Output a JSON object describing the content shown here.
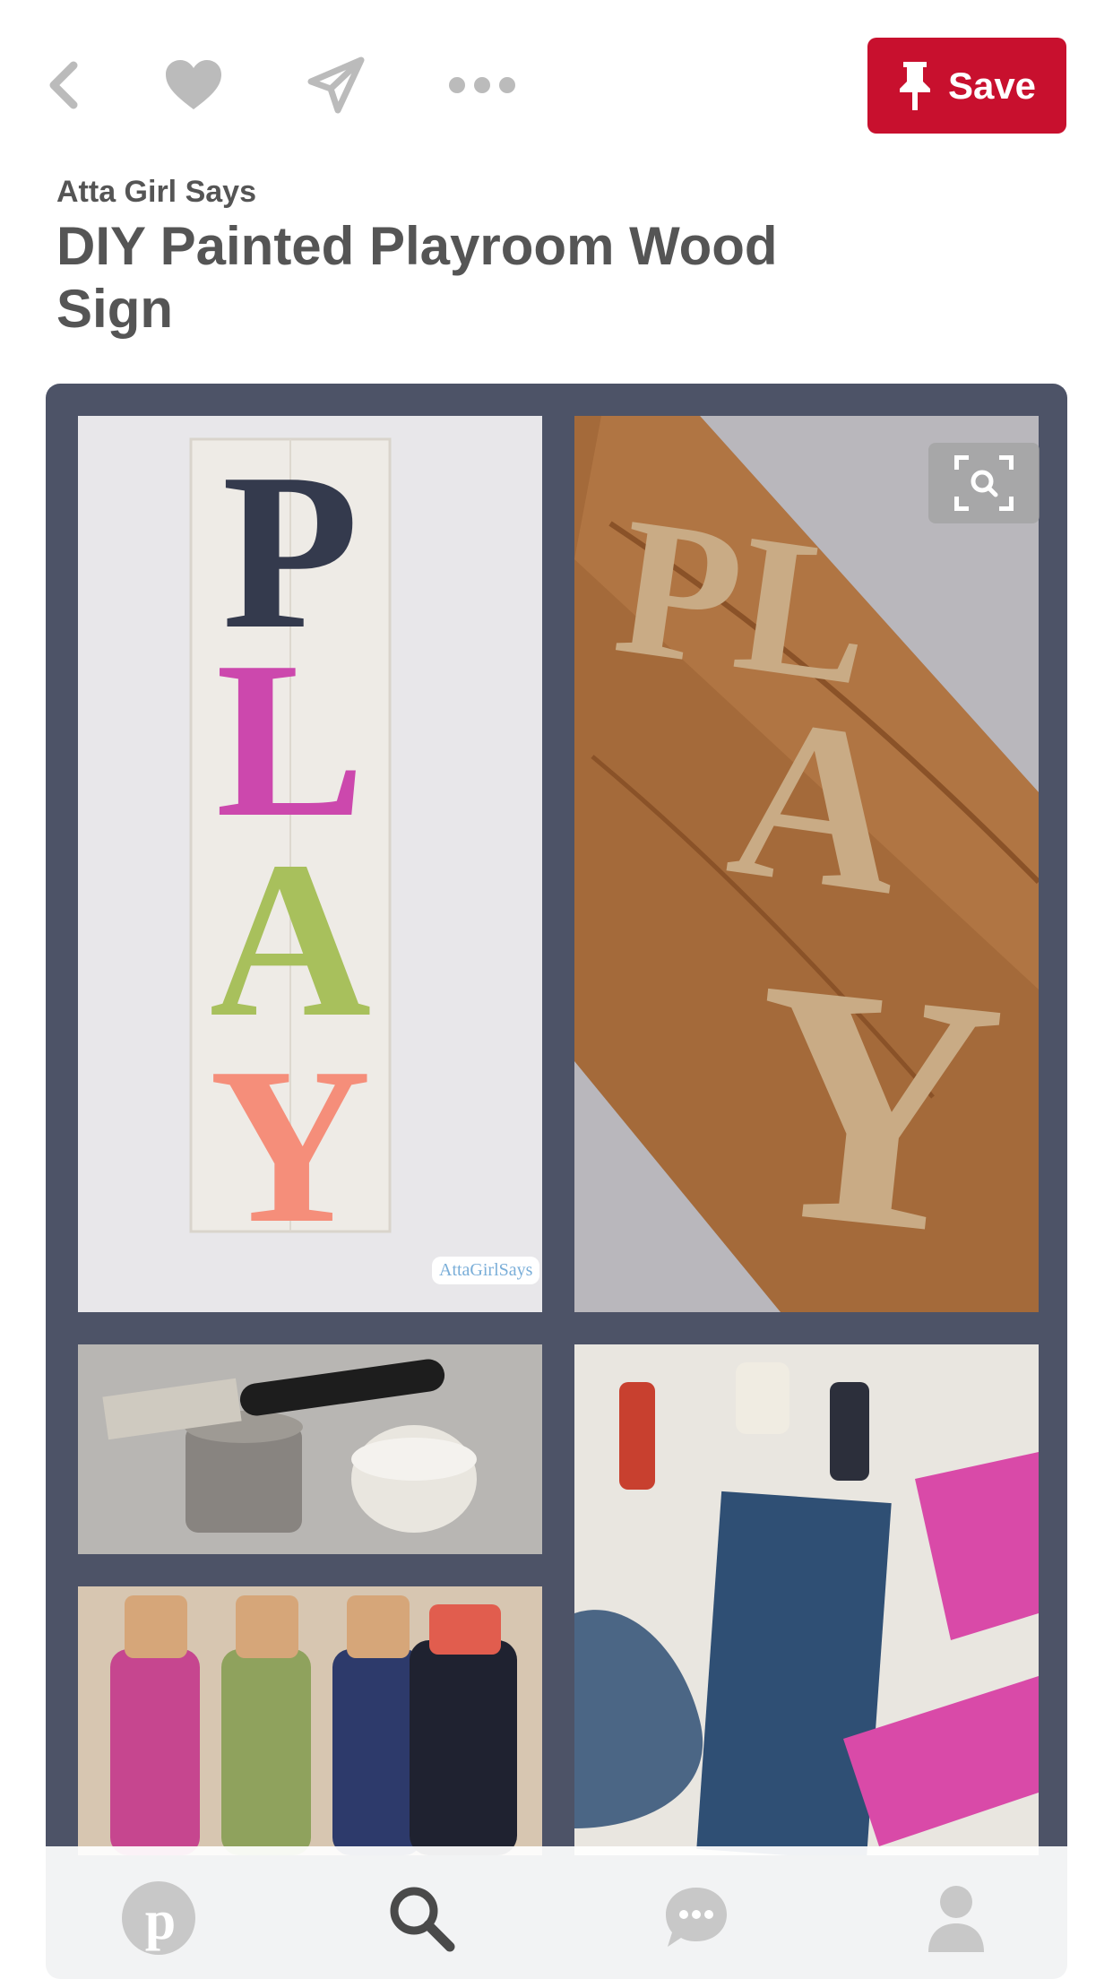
{
  "toolbar": {
    "back_icon": "chevron-left-icon",
    "like_icon": "heart-icon",
    "send_icon": "send-icon",
    "more_icon": "more-dots-icon",
    "save_label": "Save"
  },
  "pin": {
    "source": "Atta Girl Says",
    "title": "DIY Painted Playroom Wood Sign"
  },
  "images": {
    "watermark": "AttaGirlSays"
  },
  "bottom_nav": [
    {
      "icon": "pinterest-logo-icon"
    },
    {
      "icon": "search-icon"
    },
    {
      "icon": "chat-bubble-icon"
    },
    {
      "icon": "profile-icon"
    }
  ],
  "colors": {
    "save": "#c8102e",
    "collage_bg": "#4d5367",
    "icon_gray": "#bbbbbb",
    "text_dark": "#555555"
  }
}
